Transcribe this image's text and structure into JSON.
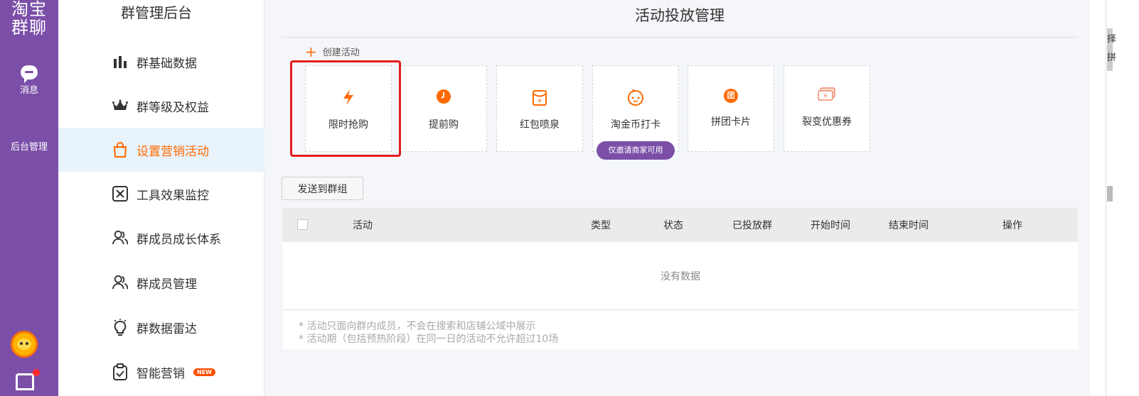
{
  "rail": {
    "logo_line1": "淘宝",
    "logo_line2": "群聊",
    "items": [
      {
        "label": "消息",
        "icon": "message-icon"
      },
      {
        "label": "后台管理",
        "icon": "bar-chart-icon"
      }
    ]
  },
  "sidebar": {
    "title": "群管理后台",
    "items": [
      {
        "label": "群基础数据",
        "icon": "bar-chart-icon"
      },
      {
        "label": "群等级及权益",
        "icon": "crown-icon"
      },
      {
        "label": "设置营销活动",
        "icon": "shopping-bag-icon",
        "active": true
      },
      {
        "label": "工具效果监控",
        "icon": "monitor-icon"
      },
      {
        "label": "群成员成长体系",
        "icon": "users-icon"
      },
      {
        "label": "群成员管理",
        "icon": "users-icon"
      },
      {
        "label": "群数据雷达",
        "icon": "lightbulb-icon"
      },
      {
        "label": "智能营销",
        "icon": "clipboard-check-icon",
        "badge": "NEW"
      }
    ]
  },
  "main": {
    "title": "活动投放管理",
    "create_label": "创建活动",
    "cards": [
      {
        "label": "限时抢购",
        "icon": "lightning-icon"
      },
      {
        "label": "提前购",
        "icon": "clock-icon"
      },
      {
        "label": "红包喷泉",
        "icon": "red-envelope-icon"
      },
      {
        "label": "淘金币打卡",
        "icon": "face-icon",
        "badge": "仅邀请商家可用"
      },
      {
        "label": "拼团卡片",
        "icon": "group-coin-icon",
        "icon_text": "团"
      },
      {
        "label": "裂变优惠券",
        "icon": "coupon-icon"
      }
    ],
    "send_button": "发送到群组",
    "table": {
      "columns": [
        "活动",
        "类型",
        "状态",
        "已投放群",
        "开始时间",
        "结束时间",
        "操作"
      ],
      "empty_text": "没有数据"
    },
    "notes": [
      "* 活动只面向群内成员，不会在搜索和店铺公域中展示",
      "* 活动期（包括预热阶段）在同一日的活动不允许超过10场"
    ]
  },
  "right_edge": {
    "t1": "择",
    "t2": "拼"
  },
  "colors": {
    "brand_purple": "#7b4fa8",
    "accent_orange": "#ff6a00",
    "highlight_red": "#e51c1c"
  }
}
